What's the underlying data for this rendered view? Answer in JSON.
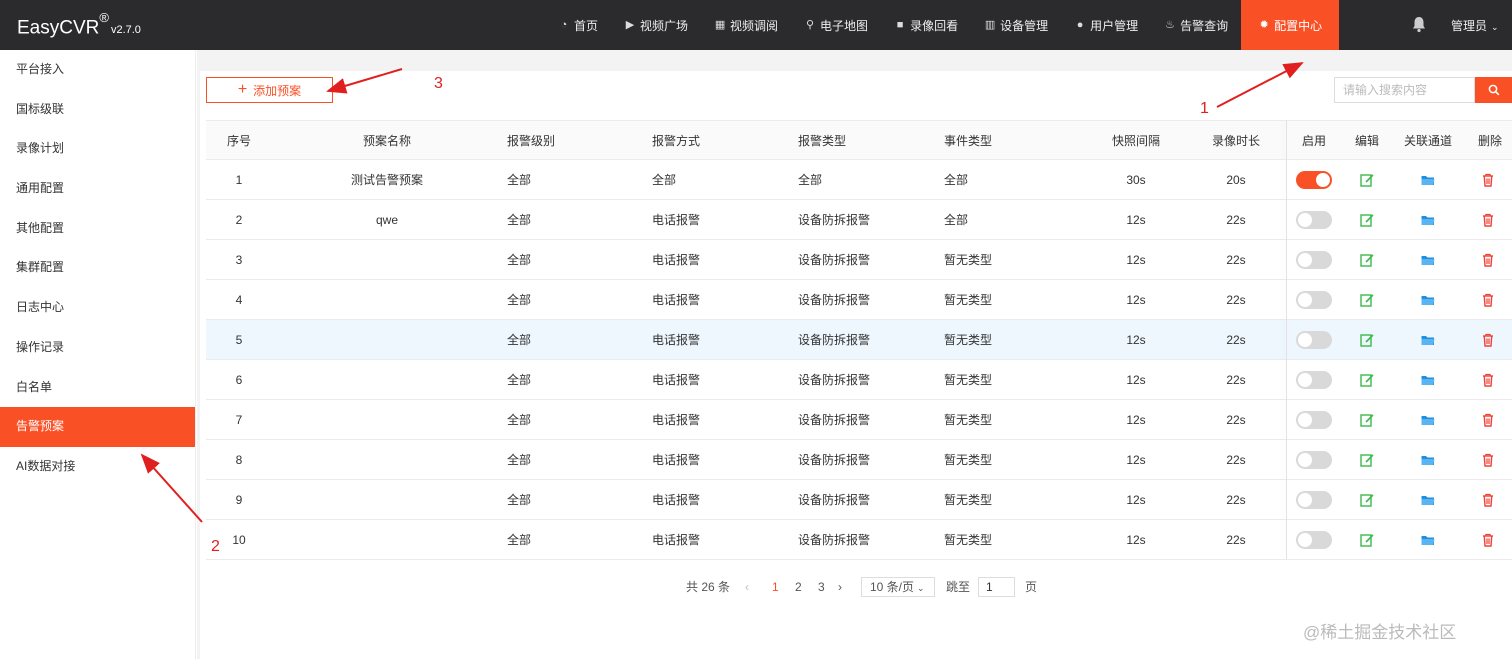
{
  "app": {
    "brand": "EasyCVR",
    "reg": "®",
    "version": "v2.7.0"
  },
  "nav": [
    {
      "label": "首页",
      "icon": "dashboard-icon"
    },
    {
      "label": "视频广场",
      "icon": "play-circle-icon"
    },
    {
      "label": "视频调阅",
      "icon": "grid-icon"
    },
    {
      "label": "电子地图",
      "icon": "map-pin-icon"
    },
    {
      "label": "录像回看",
      "icon": "video-camera-icon"
    },
    {
      "label": "设备管理",
      "icon": "device-icon"
    },
    {
      "label": "用户管理",
      "icon": "user-icon"
    },
    {
      "label": "告警查询",
      "icon": "alarm-icon"
    },
    {
      "label": "配置中心",
      "icon": "gear-icon",
      "active": true
    }
  ],
  "user": {
    "name": "管理员"
  },
  "sidebar": {
    "items": [
      {
        "label": "平台接入"
      },
      {
        "label": "国标级联"
      },
      {
        "label": "录像计划"
      },
      {
        "label": "通用配置"
      },
      {
        "label": "其他配置"
      },
      {
        "label": "集群配置"
      },
      {
        "label": "日志中心"
      },
      {
        "label": "操作记录"
      },
      {
        "label": "白名单"
      },
      {
        "label": "告警预案",
        "active": true
      },
      {
        "label": "AI数据对接"
      }
    ]
  },
  "toolbar": {
    "add_label": "添加预案",
    "search_placeholder": "请输入搜索内容"
  },
  "table": {
    "headers": [
      "序号",
      "预案名称",
      "报警级别",
      "报警方式",
      "报警类型",
      "事件类型",
      "快照间隔",
      "录像时长",
      "启用",
      "编辑",
      "关联通道",
      "删除"
    ],
    "rows": [
      {
        "no": "1",
        "name": "测试告警预案",
        "level": "全部",
        "method": "全部",
        "type": "全部",
        "event": "全部",
        "snap": "30s",
        "rec": "20s",
        "enabled": true
      },
      {
        "no": "2",
        "name": "qwe",
        "level": "全部",
        "method": "电话报警",
        "type": "设备防拆报警",
        "event": "全部",
        "snap": "12s",
        "rec": "22s",
        "enabled": false
      },
      {
        "no": "3",
        "name": "",
        "level": "全部",
        "method": "电话报警",
        "type": "设备防拆报警",
        "event": "暂无类型",
        "snap": "12s",
        "rec": "22s",
        "enabled": false
      },
      {
        "no": "4",
        "name": "",
        "level": "全部",
        "method": "电话报警",
        "type": "设备防拆报警",
        "event": "暂无类型",
        "snap": "12s",
        "rec": "22s",
        "enabled": false
      },
      {
        "no": "5",
        "name": "",
        "level": "全部",
        "method": "电话报警",
        "type": "设备防拆报警",
        "event": "暂无类型",
        "snap": "12s",
        "rec": "22s",
        "enabled": false,
        "highlighted": true
      },
      {
        "no": "6",
        "name": "",
        "level": "全部",
        "method": "电话报警",
        "type": "设备防拆报警",
        "event": "暂无类型",
        "snap": "12s",
        "rec": "22s",
        "enabled": false
      },
      {
        "no": "7",
        "name": "",
        "level": "全部",
        "method": "电话报警",
        "type": "设备防拆报警",
        "event": "暂无类型",
        "snap": "12s",
        "rec": "22s",
        "enabled": false
      },
      {
        "no": "8",
        "name": "",
        "level": "全部",
        "method": "电话报警",
        "type": "设备防拆报警",
        "event": "暂无类型",
        "snap": "12s",
        "rec": "22s",
        "enabled": false
      },
      {
        "no": "9",
        "name": "",
        "level": "全部",
        "method": "电话报警",
        "type": "设备防拆报警",
        "event": "暂无类型",
        "snap": "12s",
        "rec": "22s",
        "enabled": false
      },
      {
        "no": "10",
        "name": "",
        "level": "全部",
        "method": "电话报警",
        "type": "设备防拆报警",
        "event": "暂无类型",
        "snap": "12s",
        "rec": "22s",
        "enabled": false
      }
    ]
  },
  "pagination": {
    "total": "共 26 条",
    "pages": [
      "1",
      "2",
      "3"
    ],
    "current": "1",
    "page_size": "10 条/页",
    "jump_label": "跳至",
    "jump_value": "1",
    "page_unit": "页"
  },
  "annotations": [
    "1",
    "2",
    "3"
  ],
  "watermark": "@稀土掘金技术社区",
  "colors": {
    "accent": "#fa5025",
    "topbar": "#2b2b2e",
    "edit": "#3cb94a",
    "folder": "#1e90e0",
    "delete": "#f04134"
  }
}
